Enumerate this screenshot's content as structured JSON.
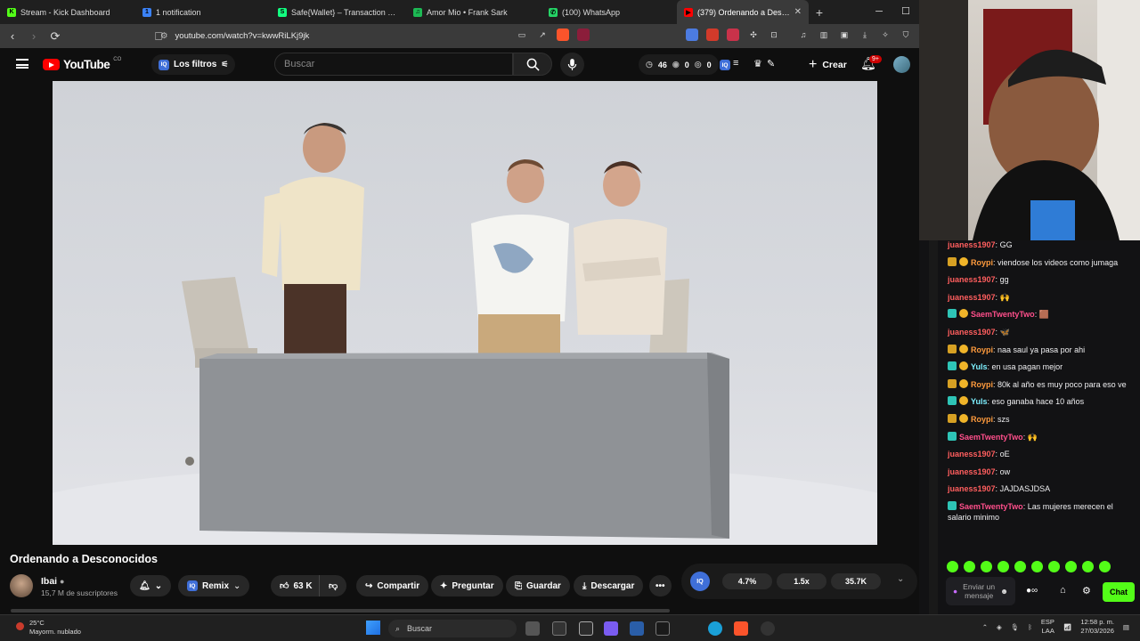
{
  "browser": {
    "tabs": [
      {
        "title": "Stream - Kick Dashboard",
        "color": "#53fc18",
        "glyph": "K"
      },
      {
        "title": "1 notification",
        "color": "#3b82f6",
        "glyph": "1"
      },
      {
        "title": "Safe{Wallet} – Transaction queue",
        "color": "#12ff80",
        "glyph": "S"
      },
      {
        "title": "Amor Mio • Frank Sark",
        "color": "#1db954",
        "glyph": "♫"
      },
      {
        "title": "(100) WhatsApp",
        "color": "#25d366",
        "glyph": "✆"
      },
      {
        "title": "(379) Ordenando a Desconocidos",
        "color": "#ff0000",
        "glyph": "▶",
        "active": true
      }
    ],
    "url": "youtube.com/watch?v=kwwRiLKj9jk"
  },
  "youtube": {
    "logo_text": "YouTube",
    "country": "CO",
    "filters_label": "Los filtros",
    "search_placeholder": "Buscar",
    "stats": {
      "views": "46",
      "a": "0",
      "b": "0"
    },
    "create_label": "Crear",
    "notif_badge": "9+",
    "video_title": "Ordenando a Desconocidos",
    "channel_name": "Ibai",
    "subscribers": "15,7 M de suscriptores",
    "remix_label": "Remix",
    "likes": "63 K",
    "share_label": "Compartir",
    "ask_label": "Preguntar",
    "save_label": "Guardar",
    "download_label": "Descargar",
    "iq_stats": [
      "4.7%",
      "1.5x",
      "35.7K"
    ]
  },
  "chat": {
    "messages": [
      {
        "user": "juaness1907",
        "color": "#ff5e5e",
        "text": "GG",
        "badges": []
      },
      {
        "user": "Roypi",
        "color": "#ff9b3d",
        "text": "viendose los videos como jumaga",
        "badges": [
          "crown",
          "sub1"
        ]
      },
      {
        "user": "juaness1907",
        "color": "#ff5e5e",
        "text": "gg",
        "badges": []
      },
      {
        "user": "juaness1907",
        "color": "#ff5e5e",
        "text": "🙌",
        "badges": []
      },
      {
        "user": "SaemTwentyTwo",
        "color": "#ff4f8b",
        "text": "🟫",
        "badges": [
          "kick",
          "sub1"
        ]
      },
      {
        "user": "juaness1907",
        "color": "#ff5e5e",
        "text": "🦋",
        "badges": []
      },
      {
        "user": "Roypi",
        "color": "#ff9b3d",
        "text": "naa saul ya pasa por ahi",
        "badges": [
          "crown",
          "sub1"
        ]
      },
      {
        "user": "Yuls",
        "color": "#7ef0ff",
        "text": "en usa pagan mejor",
        "badges": [
          "kick",
          "sub1"
        ]
      },
      {
        "user": "Roypi",
        "color": "#ff9b3d",
        "text": "80k al año es muy poco para eso ve",
        "badges": [
          "crown",
          "sub1"
        ]
      },
      {
        "user": "Yuls",
        "color": "#7ef0ff",
        "text": "eso ganaba hace 10 años",
        "badges": [
          "kick",
          "sub1"
        ]
      },
      {
        "user": "Roypi",
        "color": "#ff9b3d",
        "text": "szs",
        "badges": [
          "crown",
          "sub1"
        ]
      },
      {
        "user": "SaemTwentyTwo",
        "color": "#ff4f8b",
        "text": "🙌",
        "badges": [
          "kick"
        ]
      },
      {
        "user": "juaness1907",
        "color": "#ff5e5e",
        "text": "oE",
        "badges": []
      },
      {
        "user": "juaness1907",
        "color": "#ff5e5e",
        "text": "ow",
        "badges": []
      },
      {
        "user": "juaness1907",
        "color": "#ff5e5e",
        "text": "JAJDASJDSA",
        "badges": []
      },
      {
        "user": "SaemTwentyTwo",
        "color": "#ff4f8b",
        "text": "Las mujeres merecen el salario minimo",
        "badges": [
          "kick"
        ]
      }
    ],
    "input_placeholder": "Enviar un mensaje",
    "send_label": "Chat"
  },
  "taskbar": {
    "temp": "25°C",
    "weather": "Mayorm. nublado",
    "search_placeholder": "Buscar",
    "lang": "ESP",
    "lang2": "LAA",
    "time": "12:58 p. m.",
    "date": "27/03/2026"
  }
}
